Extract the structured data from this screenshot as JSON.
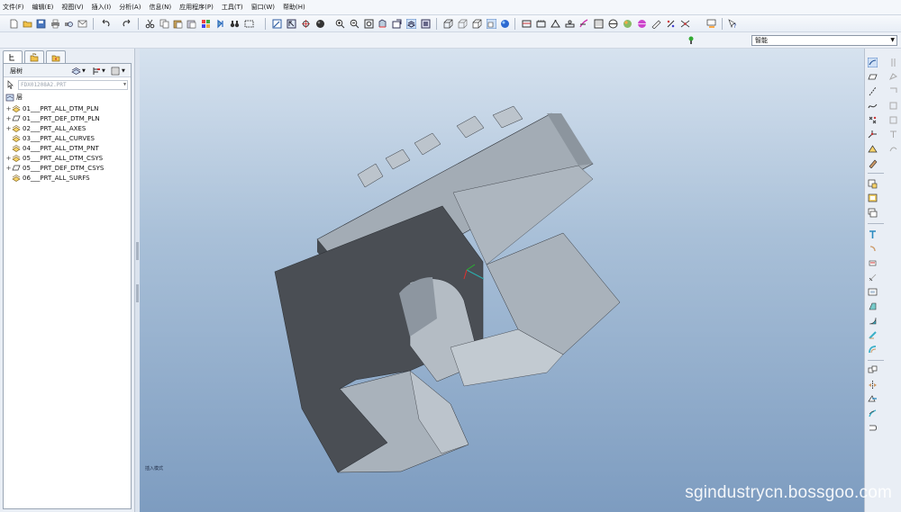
{
  "menubar": {
    "items": [
      "文件(F)",
      "编辑(E)",
      "视图(V)",
      "插入(I)",
      "分析(A)",
      "信息(N)",
      "应用程序(P)",
      "工具(T)",
      "窗口(W)",
      "帮助(H)"
    ]
  },
  "toolbar": {
    "icons": [
      "new-file-icon",
      "open-folder-icon",
      "save-icon",
      "print-icon",
      "print-preview-icon",
      "email-icon",
      "undo-icon",
      "redo-icon",
      "cut-icon",
      "copy-icon",
      "paste-icon",
      "paste-special-icon",
      "regenerate-icon",
      "find-icon",
      "select-box-icon",
      "repaint-icon",
      "orient-icon",
      "spin-center-icon",
      "display-style-icon",
      "zoom-in-icon",
      "zoom-out-icon",
      "refit-icon",
      "reorient-icon",
      "named-views-icon",
      "layers-icon",
      "view-manager-icon",
      "wireframe-icon",
      "hidden-line-icon",
      "no-hidden-icon",
      "shading-icon",
      "enhanced-realism-icon",
      "datum-plane-display-icon",
      "datum-axis-display-icon",
      "point-display-icon",
      "csys-display-icon",
      "annotation-display-icon",
      "appearance-icon",
      "scene-icon",
      "spot-light-icon",
      "material-icon",
      "measure-icon",
      "section-icon",
      "plane-icon",
      "context-help-icon"
    ]
  },
  "filter": {
    "value": "智能"
  },
  "left_panel": {
    "tabs": [
      "model-tree-tab-icon",
      "folder-browser-tab-icon",
      "favorites-tab-icon"
    ],
    "layer_title": "层树",
    "selector_value": "FDX01208A2.PRT",
    "root_label": "层",
    "layers": [
      {
        "label": "01___PRT_ALL_DTM_PLN",
        "expandable": true,
        "icon": "layer-icon"
      },
      {
        "label": "01___PRT_DEF_DTM_PLN",
        "expandable": true,
        "icon": "datum-plane-layer-icon"
      },
      {
        "label": "02___PRT_ALL_AXES",
        "expandable": true,
        "icon": "layer-icon"
      },
      {
        "label": "03___PRT_ALL_CURVES",
        "expandable": false,
        "icon": "layer-icon"
      },
      {
        "label": "04___PRT_ALL_DTM_PNT",
        "expandable": false,
        "icon": "layer-icon"
      },
      {
        "label": "05___PRT_ALL_DTM_CSYS",
        "expandable": true,
        "icon": "layer-icon"
      },
      {
        "label": "05___PRT_DEF_DTM_CSYS",
        "expandable": true,
        "icon": "datum-plane-layer-icon"
      },
      {
        "label": "06___PRT_ALL_SURFS",
        "expandable": false,
        "icon": "layer-icon"
      }
    ]
  },
  "viewport": {
    "coord_label": "插入模式",
    "colors": {
      "dark_face": "#4a4e54",
      "light_face": "#a9b2bb",
      "top_face": "#bcc4cc",
      "edge": "#2f3338",
      "bg_top": "#d6e2ef",
      "bg_bottom": "#7d9cc0"
    }
  },
  "right_toolbar": {
    "icons": [
      "sketch-icon",
      "plane-tool-icon",
      "axis-tool-icon",
      "curve-tool-icon",
      "point-tool-icon",
      "csys-tool-icon",
      "analysis-feature-icon",
      "style-icon",
      "insert-shared-data-icon",
      "user-defined-feature-icon",
      "copy-geometry-icon",
      "extrude-icon",
      "revolve-icon",
      "variable-section-sweep-icon",
      "boundary-blend-icon",
      "shell-icon",
      "draft-icon",
      "round-icon",
      "chamfer-icon",
      "rib-icon",
      "mirror-icon",
      "merge-icon",
      "trim-icon",
      "pattern-icon",
      "offset-icon"
    ]
  },
  "watermark": "sgindustrycn.bossgoo.com"
}
